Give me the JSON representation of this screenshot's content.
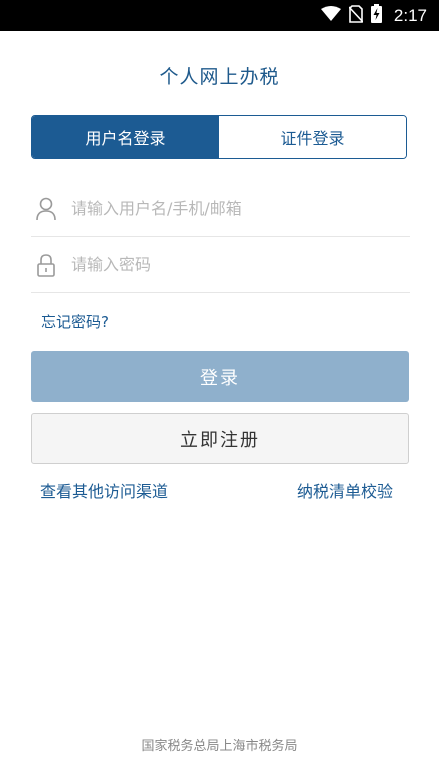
{
  "status_bar": {
    "time": "2:17",
    "icons": [
      "wifi-icon",
      "no-sim-icon",
      "battery-charging-icon"
    ]
  },
  "page": {
    "title": "个人网上办税"
  },
  "tabs": [
    {
      "label": "用户名登录",
      "active": true
    },
    {
      "label": "证件登录",
      "active": false
    }
  ],
  "form": {
    "username": {
      "placeholder": "请输入用户名/手机/邮箱",
      "value": "",
      "icon": "user-icon"
    },
    "password": {
      "placeholder": "请输入密码",
      "value": "",
      "icon": "lock-icon"
    },
    "forgot_label": "忘记密码?",
    "login_label": "登录",
    "register_label": "立即注册"
  },
  "links": {
    "other_channels": "查看其他访问渠道",
    "tax_list_check": "纳税清单校验"
  },
  "footer": {
    "text": "国家税务总局上海市税务局"
  },
  "colors": {
    "primary": "#1c5b93",
    "login_button": "#8fb0cc",
    "placeholder": "#b8b8b8"
  }
}
